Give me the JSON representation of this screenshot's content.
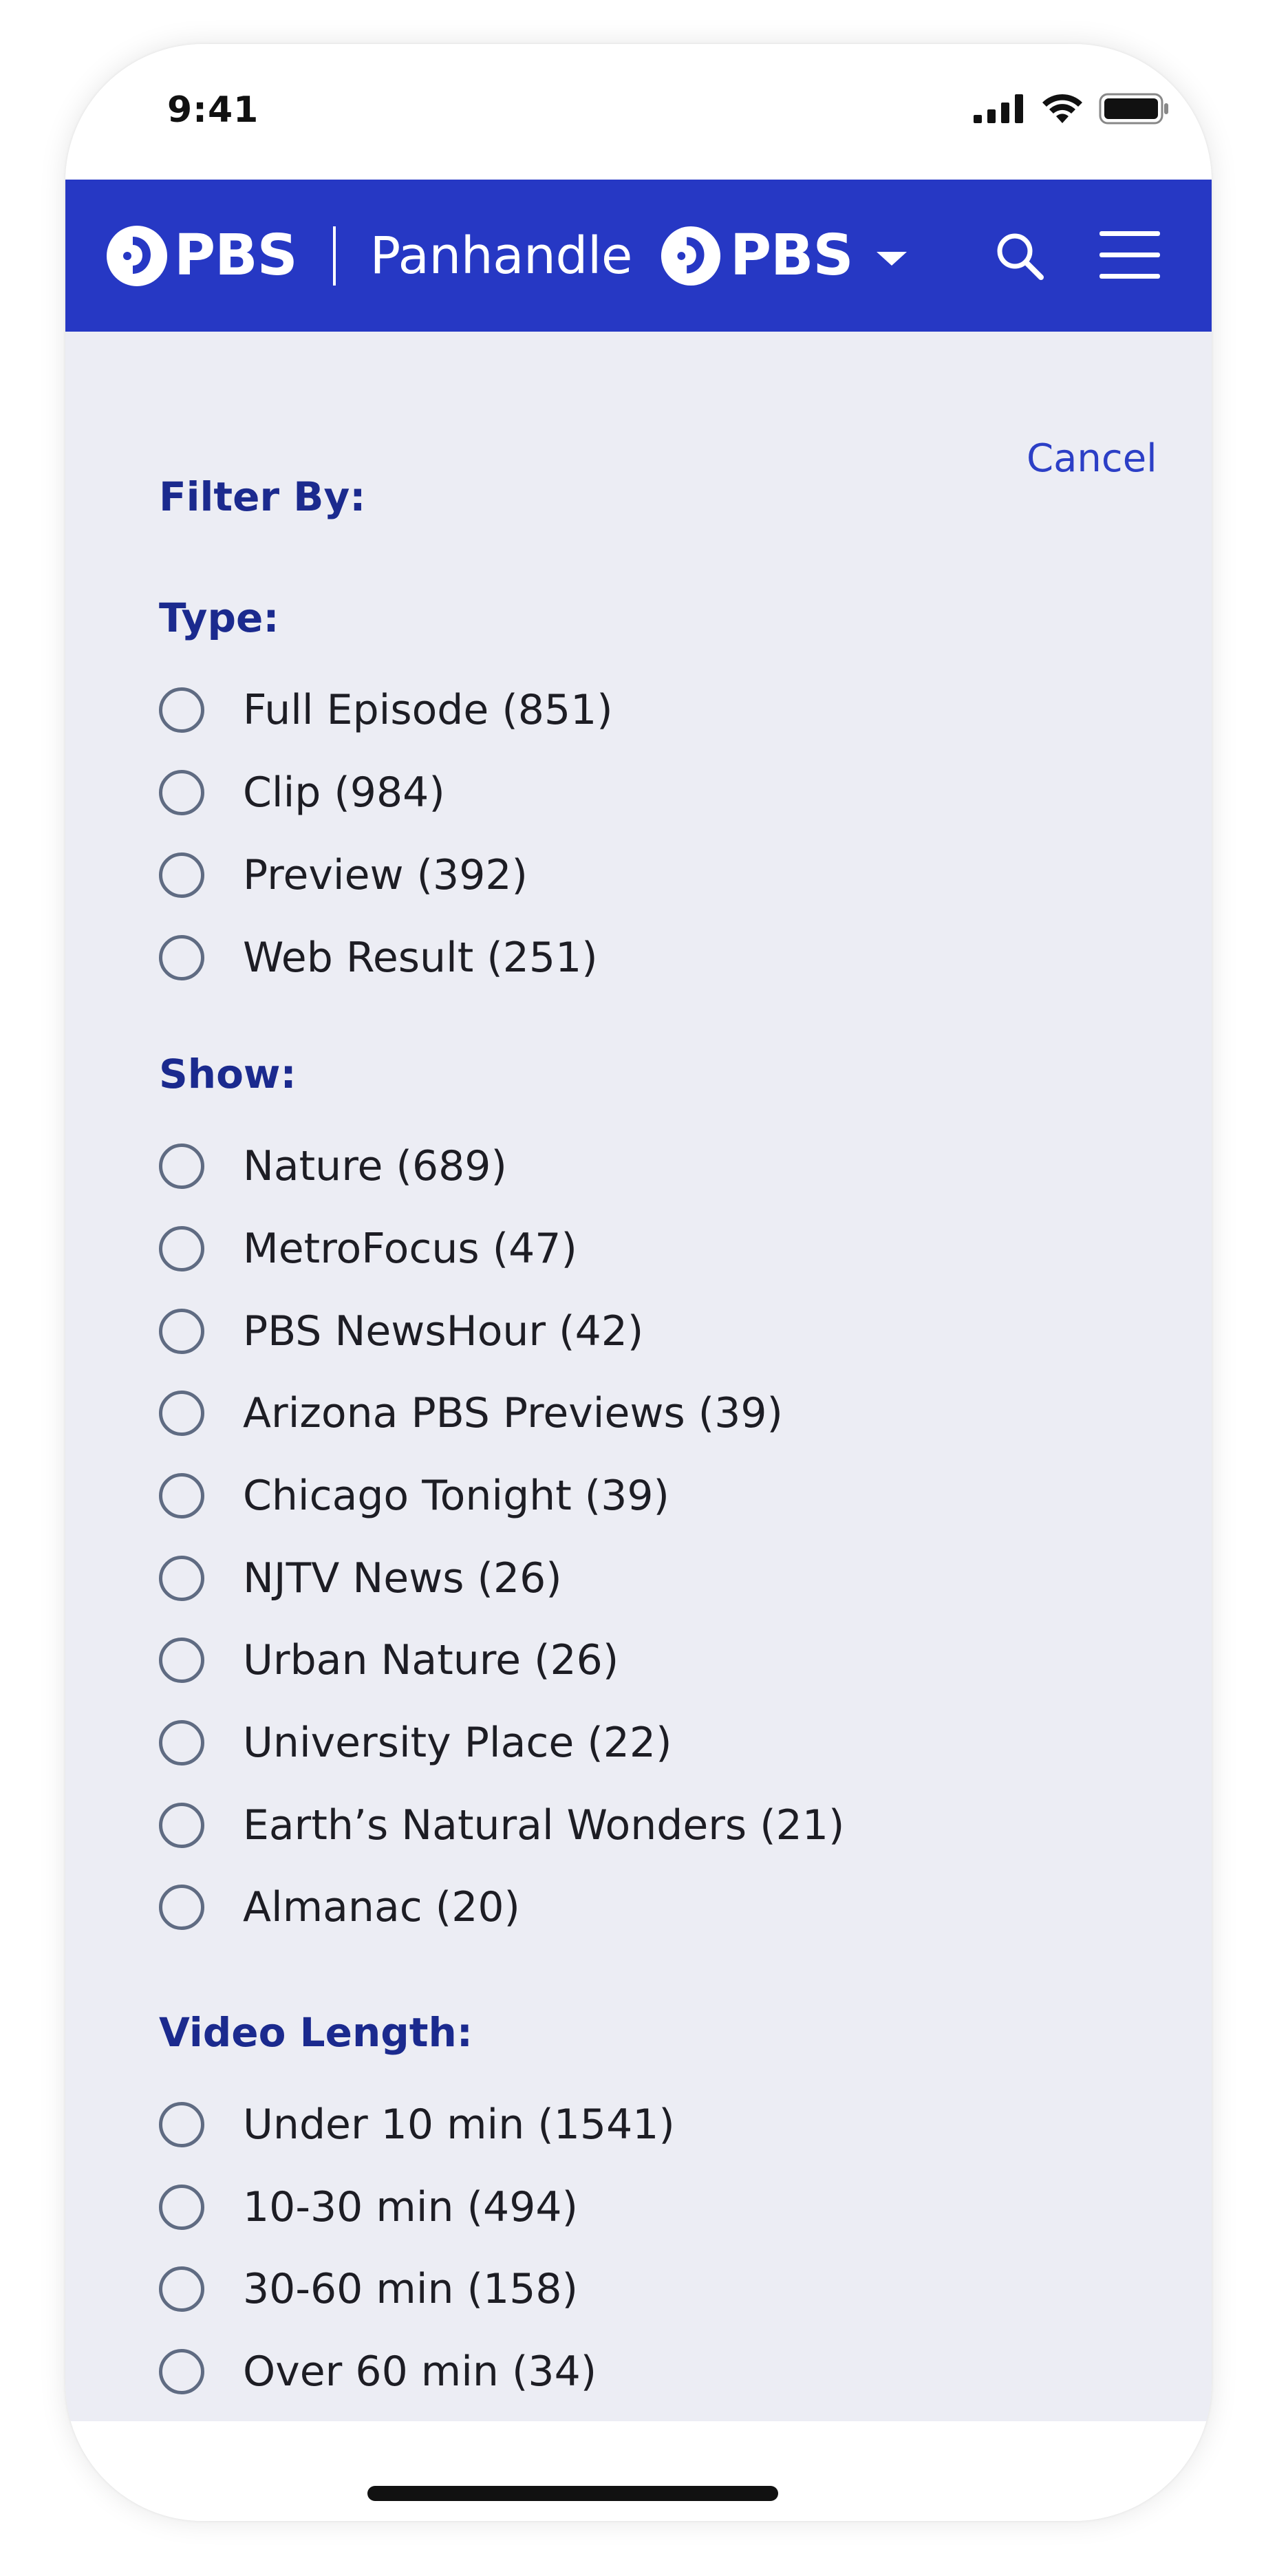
{
  "status_bar": {
    "time": "9:41"
  },
  "header": {
    "logo_text": "PBS",
    "station_name": "Panhandle",
    "station_logo_text": "PBS",
    "brand_color": "#2638c4"
  },
  "filter": {
    "cancel_label": "Cancel",
    "title": "Filter By:",
    "sections": [
      {
        "title": "Type:",
        "options": [
          "Full Episode (851)",
          "Clip (984)",
          "Preview (392)",
          "Web Result (251)"
        ]
      },
      {
        "title": "Show:",
        "options": [
          "Nature (689)",
          "MetroFocus (47)",
          "PBS NewsHour (42)",
          "Arizona PBS Previews (39)",
          "Chicago Tonight (39)",
          "NJTV News (26)",
          "Urban Nature (26)",
          "University Place (22)",
          "Earth’s Natural Wonders (21)",
          "Almanac (20)"
        ]
      },
      {
        "title": "Video Length:",
        "options": [
          "Under 10 min (1541)",
          "10-30 min (494)",
          "30-60 min (158)",
          "Over 60 min (34)"
        ]
      }
    ]
  },
  "icons": {
    "signal": "cellular-signal-icon",
    "wifi": "wifi-icon",
    "battery": "battery-icon",
    "search": "search-icon",
    "menu": "hamburger-menu-icon",
    "dropdown": "chevron-down-icon"
  }
}
